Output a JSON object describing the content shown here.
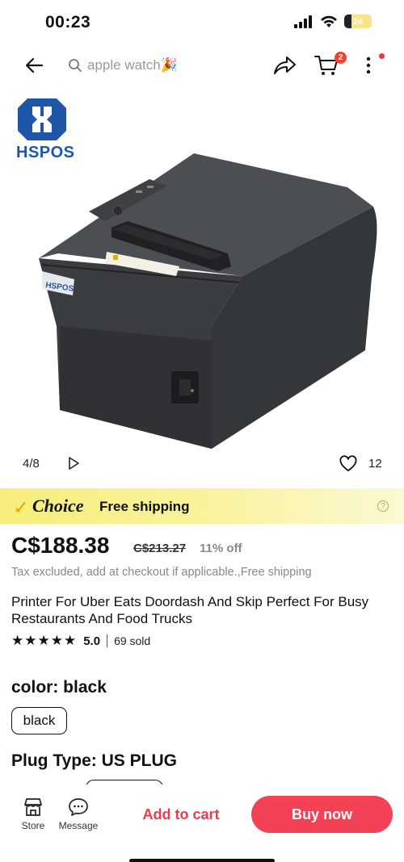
{
  "status_bar": {
    "time": "00:23",
    "battery": "24"
  },
  "nav": {
    "search_text": "apple watch🎉",
    "cart_count": "2"
  },
  "product_image": {
    "brand": "HSPOS",
    "counter": "4/8",
    "favorites": "12"
  },
  "choice_banner": {
    "label": "Choice",
    "shipping": "Free shipping"
  },
  "pricing": {
    "price": "C$188.38",
    "old_price": "C$213.27",
    "discount": "11% off",
    "tax_note": "Tax excluded, add at checkout if applicable.,Free shipping"
  },
  "product": {
    "title": "Printer For Uber Eats Doordash And Skip Perfect For Busy Restaurants And Food Trucks",
    "stars": "★★★★★",
    "rating": "5.0",
    "sold": "69 sold"
  },
  "options": {
    "color_label": "color: black",
    "color_value": "black",
    "plug_label": "Plug Type: US PLUG"
  },
  "bottom_bar": {
    "store_label": "Store",
    "message_label": "Message",
    "add_to_cart": "Add to cart",
    "buy_now": "Buy now"
  },
  "colors": {
    "accent_red": "#f34156",
    "choice_yellow": "#f6ed7a",
    "brand_blue": "#1e56a8"
  }
}
